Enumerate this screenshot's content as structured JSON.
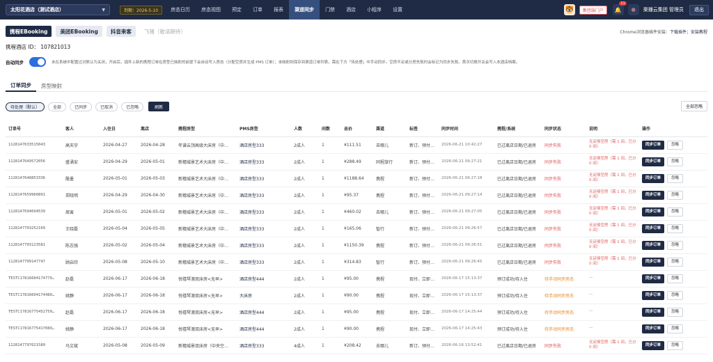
{
  "header": {
    "hotel_select": "太阳花酒店（测试酒店）",
    "date_badge": "到期：2026-5-10",
    "nav": [
      "房态日历",
      "房态视图",
      "预定",
      "订单",
      "报表",
      "渠道同步",
      "门禁",
      "酒店",
      "小程序",
      "设置"
    ],
    "active_nav": 5,
    "group_portal": "集团端门户",
    "notification_count": "11",
    "user_name": "渠播云集团 管理员",
    "logout": "退出"
  },
  "platform_tabs": [
    {
      "label": "携程EBooking",
      "state": "active"
    },
    {
      "label": "美团EBooking",
      "state": "normal"
    },
    {
      "label": "抖音来客",
      "state": "normal"
    },
    {
      "label": "飞猪（敬请期待）",
      "state": "disabled"
    }
  ],
  "plugin_note": {
    "text": "Chrome浏览器插件安装：",
    "download": "下载插件",
    "tutorial": "安装教程"
  },
  "hotel_id": "携程酒店 ID： 107821013",
  "auto_sync": {
    "label": "自动同步",
    "enabled": true,
    "desc": "未在系统中配置过对默认为关闭，开启后，插件上新的携程订单在房型已映射的前提下会自动写入房态（分配空房并生成 PMS 订单）；未映射则保存到渠道订单列表，需在下方「待处理」中手动同步。空房不足或分房失败时会标记为同步失败。首次切换开关会写入本酒店档案。"
  },
  "sub_tabs": [
    {
      "label": "订单同步",
      "active": true
    },
    {
      "label": "房型映射",
      "active": false
    }
  ],
  "filters": [
    {
      "label": "待处理（默认）",
      "active": true
    },
    {
      "label": "全部",
      "active": false
    },
    {
      "label": "已同步",
      "active": false
    },
    {
      "label": "已取消",
      "active": false
    },
    {
      "label": "已忽略",
      "active": false
    }
  ],
  "refresh": "刷新",
  "ignore_all": "全部忽略",
  "table": {
    "columns": [
      "订单号",
      "客人",
      "入住日",
      "离店",
      "携程房型",
      "PMS房型",
      "人数",
      "间数",
      "总价",
      "渠道",
      "标签",
      "同步时间",
      "携程/系统",
      "同步状态",
      "说明",
      "操作"
    ],
    "sync_label": "同步订单",
    "ignore_label": "忽略",
    "rows": [
      {
        "order": "1128147633515043",
        "guest": "高天宇",
        "checkin": "2026-04-27",
        "checkout": "2026-04-28",
        "ctrip_room": "年谱云顶高级大床房（中…",
        "pms_room": "酒店房型333",
        "people": "2成人",
        "rooms": "1",
        "price": "¥111.51",
        "channel": "去哪儿",
        "tags": "新订、预付…",
        "sync_time": "2026-06-21 10:42:27",
        "system": "已过离店日期/已退房",
        "status": "同步失败",
        "status_type": "fail",
        "desc": "无足够空房（需 1 间，已分 0 间）"
      },
      {
        "order": "1128147649572056",
        "guest": "盛涌安",
        "checkin": "2026-04-29",
        "checkout": "2026-05-01",
        "ctrip_room": "新穗城景艺术大床房（中…",
        "pms_room": "酒店房型333",
        "people": "2成人",
        "rooms": "1",
        "price": "¥288.49",
        "channel": "同程旅行",
        "tags": "新订、预付…",
        "sync_time": "2026-06-21 09:27:21",
        "system": "已过离店日期/已退房",
        "status": "同步失败",
        "status_type": "fail",
        "desc": "无足够空房（需 1 间，已分 0 间）"
      },
      {
        "order": "1128147648853336",
        "guest": "殷墨",
        "checkin": "2026-05-01",
        "checkout": "2026-05-03",
        "ctrip_room": "新穗城景艺术大床房（中…",
        "pms_room": "酒店房型333",
        "people": "2成人",
        "rooms": "1",
        "price": "¥1188.64",
        "channel": "携程",
        "tags": "新订、预付…",
        "sync_time": "2026-06-21 09:27:18",
        "system": "已过离店日期/已退房",
        "status": "同步失败",
        "status_type": "fail",
        "desc": "无足够空房（需 1 间，已分 0 间）"
      },
      {
        "order": "1128147659960891",
        "guest": "郑晓明",
        "checkin": "2026-04-29",
        "checkout": "2026-04-30",
        "ctrip_room": "新穗城景艺术大床房（中…",
        "pms_room": "酒店房型333",
        "people": "2成人",
        "rooms": "1",
        "price": "¥95.37",
        "channel": "携程",
        "tags": "新订、预付…",
        "sync_time": "2026-06-21 09:27:14",
        "system": "已过离店日期/已退房",
        "status": "同步失败",
        "status_type": "fail",
        "desc": "无足够空房（需 1 间，已分 0 间）"
      },
      {
        "order": "1128147694694539",
        "guest": "周寅",
        "checkin": "2026-05-01",
        "checkout": "2026-05-02",
        "ctrip_room": "新穗城景艺术大床房（中…",
        "pms_room": "酒店房型333",
        "people": "2成人",
        "rooms": "1",
        "price": "¥460.02",
        "channel": "去哪儿",
        "tags": "新订、预付…",
        "sync_time": "2026-06-21 09:27:05",
        "system": "已过离店日期/已退房",
        "status": "同步失败",
        "status_type": "fail",
        "desc": "无足够空房（需 1 间，已分 0 间）"
      },
      {
        "order": "1128147703252169",
        "guest": "王晓磊",
        "checkin": "2026-05-04",
        "checkout": "2026-05-05",
        "ctrip_room": "新穗城景艺术大床房（中…",
        "pms_room": "酒店房型333",
        "people": "2成人",
        "rooms": "1",
        "price": "¥165.06",
        "channel": "智行",
        "tags": "新订、预付…",
        "sync_time": "2026-06-21 09:26:57",
        "system": "已过离店日期/已退房",
        "status": "同步失败",
        "status_type": "fail",
        "desc": "无足够空房（需 1 间，已分 0 间）"
      },
      {
        "order": "1128147703123581",
        "guest": "陈志强",
        "checkin": "2026-05-02",
        "checkout": "2026-05-04",
        "ctrip_room": "新穗城景艺术大床房（中…",
        "pms_room": "酒店房型333",
        "people": "2成人",
        "rooms": "1",
        "price": "¥1150.39",
        "channel": "携程",
        "tags": "新订、预付…",
        "sync_time": "2026-06-21 09:26:51",
        "system": "已过离店日期/已退房",
        "status": "同步失败",
        "status_type": "fail",
        "desc": "无足够空房（需 1 间，已分 0 间）"
      },
      {
        "order": "1128147709147747",
        "guest": "顾启欣",
        "checkin": "2026-05-08",
        "checkout": "2026-05-10",
        "ctrip_room": "新穗城景艺术大床房（中…",
        "pms_room": "酒店房型333",
        "people": "2成人",
        "rooms": "1",
        "price": "¥314.83",
        "channel": "智行",
        "tags": "新订、预付…",
        "sync_time": "2026-06-21 09:26:45",
        "system": "已过离店日期/已退房",
        "status": "同步失败",
        "status_type": "fail",
        "desc": "无足够空房（需 1 间，已分 0 间）"
      },
      {
        "order": "TESTC17816604174779…",
        "guest": "赵磊",
        "checkin": "2026-06-17",
        "checkout": "2026-06-18",
        "ctrip_room": "悦禧琴澳双床房<无早>",
        "pms_room": "酒店房型444",
        "people": "2成人",
        "rooms": "1",
        "price": "¥95.00",
        "channel": "携程",
        "tags": "现付、立即…",
        "sync_time": "2026-06-17 15:13:37",
        "system": "预订成功/待入住",
        "status": "待手动同步房态",
        "status_type": "pending",
        "desc": "—"
      },
      {
        "order": "TESTC17816604174480…",
        "guest": "姚静",
        "checkin": "2026-06-17",
        "checkout": "2026-06-18",
        "ctrip_room": "悦禧琴澳双床房<无早>",
        "pms_room": "大床房",
        "people": "2成人",
        "rooms": "1",
        "price": "¥90.00",
        "channel": "携程",
        "tags": "现付、立即…",
        "sync_time": "2026-06-17 15:13:37",
        "system": "预订成功/待入住",
        "status": "待手动同步房态",
        "status_type": "pending",
        "desc": "—"
      },
      {
        "order": "TESTC17816775452750…",
        "guest": "赵磊",
        "checkin": "2026-06-17",
        "checkout": "2026-06-18",
        "ctrip_room": "悦禧琴澳双床房<无早>",
        "pms_room": "酒店房型444",
        "people": "2成人",
        "rooms": "1",
        "price": "¥95.00",
        "channel": "携程",
        "tags": "现付、立即…",
        "sync_time": "2026-06-17 14:25:44",
        "system": "预订成功/待入住",
        "status": "待手动同步房态",
        "status_type": "pending",
        "desc": "—"
      },
      {
        "order": "TESTC17816775417089…",
        "guest": "姚静",
        "checkin": "2026-06-17",
        "checkout": "2026-06-18",
        "ctrip_room": "悦禧琴澳双床房<无早>",
        "pms_room": "酒店房型444",
        "people": "2成人",
        "rooms": "1",
        "price": "¥90.00",
        "channel": "携程",
        "tags": "现付、立即…",
        "sync_time": "2026-06-17 14:25:43",
        "system": "预订成功/待入住",
        "status": "待手动同步房态",
        "status_type": "pending",
        "desc": "—"
      },
      {
        "order": "1128147797621589",
        "guest": "马文斌",
        "checkin": "2026-05-08",
        "checkout": "2026-05-09",
        "ctrip_room": "新穗城景双床房（中央空…",
        "pms_room": "酒店房型333",
        "people": "4成人",
        "rooms": "1",
        "price": "¥208.42",
        "channel": "去哪儿",
        "tags": "新订、预付…",
        "sync_time": "2026-06-16 13:52:41",
        "system": "已过离店日期/已退房",
        "status": "同步失败",
        "status_type": "fail",
        "desc": "无足够空房（需 1 间，已分 0 间）"
      }
    ]
  }
}
